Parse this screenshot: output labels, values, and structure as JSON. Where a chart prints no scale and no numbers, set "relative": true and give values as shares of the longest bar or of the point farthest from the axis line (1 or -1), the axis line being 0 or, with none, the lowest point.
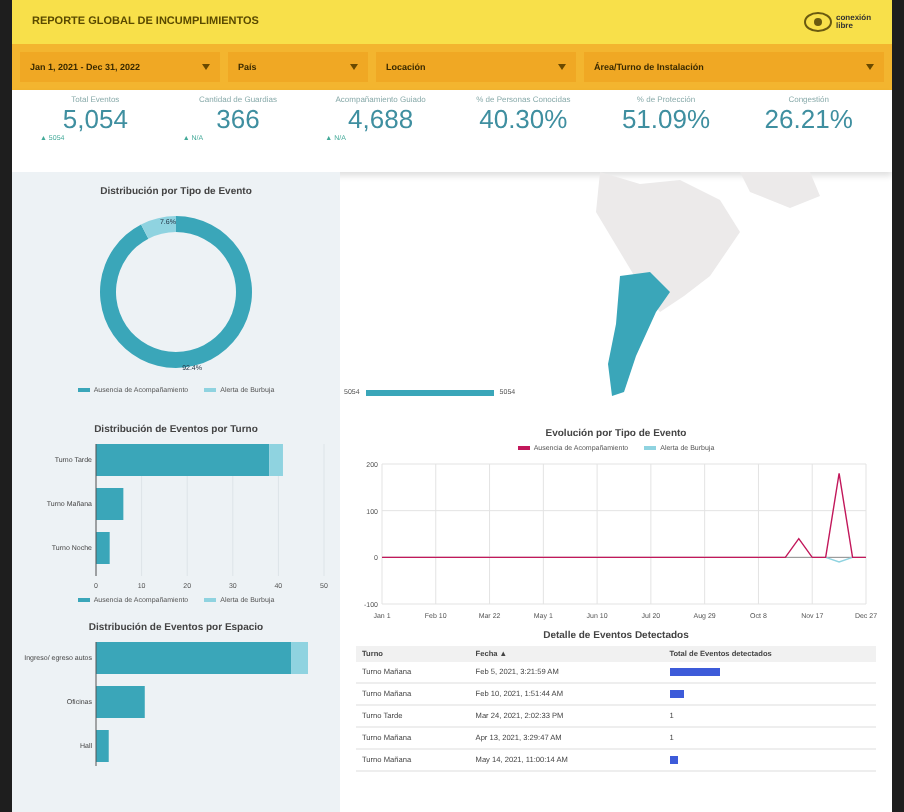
{
  "header": {
    "title": "REPORTE GLOBAL DE INCUMPLIMIENTOS",
    "logo_text": "conexión libre"
  },
  "filters": [
    {
      "label": "Jan 1, 2021 - Dec 31, 2022"
    },
    {
      "label": "País"
    },
    {
      "label": "Locación"
    },
    {
      "label": "Área/Turno de Instalación"
    }
  ],
  "kpis": [
    {
      "label": "Total Eventos",
      "value": "5,054",
      "delta": "▲ 5054"
    },
    {
      "label": "Cantidad de Guardias",
      "value": "366",
      "delta": "▲ N/A"
    },
    {
      "label": "Acompañamiento Guiado",
      "value": "4,688",
      "delta": "▲ N/A"
    },
    {
      "label": "% de Personas Conocidas",
      "value": "40.30%"
    },
    {
      "label": "% de Protección",
      "value": "51.09%"
    },
    {
      "label": "Congestión",
      "value": "26.21%"
    }
  ],
  "donut": {
    "title": "Distribución por Tipo de Evento",
    "chart_data": {
      "type": "donut",
      "categories": [
        "Ausencia de Acompañamiento",
        "Alerta de Burbuja"
      ],
      "values": [
        92.4,
        7.6
      ],
      "colors": [
        "#3aa6b9",
        "#8fd3e0"
      ],
      "value_labels": [
        "92.4%",
        "7.6%"
      ]
    }
  },
  "map": {
    "legend_min": "5054",
    "legend_max": "5054"
  },
  "turno_chart": {
    "title": "Distribución de Eventos por Turno",
    "chart_data": {
      "type": "bar",
      "orientation": "horizontal",
      "stacked": true,
      "categories": [
        "Turno Tarde",
        "Turno Mañana",
        "Turno Noche"
      ],
      "series": [
        {
          "name": "Ausencia de Acompañamiento",
          "color": "#3aa6b9",
          "values": [
            38,
            6,
            3
          ]
        },
        {
          "name": "Alerta de Burbuja",
          "color": "#8fd3e0",
          "values": [
            3,
            0,
            0
          ]
        }
      ],
      "xlim": [
        0,
        50
      ],
      "grid": true,
      "xticks": [
        0,
        10,
        20,
        30,
        40,
        50
      ]
    }
  },
  "espacio_chart": {
    "title": "Distribución de Eventos por Espacio",
    "chart_data": {
      "type": "bar",
      "orientation": "horizontal",
      "stacked": true,
      "relative": true,
      "categories": [
        "Ingreso/ egreso autos",
        "Oficinas",
        "Hall"
      ],
      "series": [
        {
          "color": "#3aa6b9",
          "values": [
            0.92,
            0.23,
            0.06
          ]
        },
        {
          "color": "#8fd3e0",
          "values": [
            0.08,
            0,
            0
          ]
        }
      ]
    }
  },
  "line_chart": {
    "title": "Evolución por Tipo de Evento",
    "chart_data": {
      "type": "line",
      "categories": [
        "Jan 1",
        null,
        null,
        null,
        "Feb 10",
        null,
        null,
        null,
        "Mar 22",
        null,
        null,
        null,
        "May 1",
        null,
        null,
        null,
        "Jun 10",
        null,
        null,
        null,
        "Jul 20",
        null,
        null,
        null,
        "Aug 29",
        null,
        null,
        null,
        "Oct 8",
        null,
        null,
        null,
        "Nov 17",
        null,
        null,
        null,
        "Dec 27"
      ],
      "series": [
        {
          "name": "Ausencia de Acompañamiento",
          "color": "#c2185b",
          "values": [
            0,
            0,
            0,
            0,
            0,
            0,
            0,
            0,
            0,
            0,
            0,
            0,
            0,
            0,
            0,
            0,
            0,
            0,
            0,
            0,
            0,
            0,
            0,
            0,
            0,
            0,
            0,
            0,
            0,
            0,
            0,
            40,
            0,
            0,
            180,
            0,
            0
          ]
        },
        {
          "name": "Alerta de Burbuja",
          "color": "#8fd3e0",
          "values": [
            null,
            null,
            null,
            null,
            null,
            null,
            null,
            null,
            null,
            null,
            null,
            null,
            null,
            null,
            null,
            null,
            null,
            null,
            null,
            null,
            null,
            null,
            null,
            null,
            null,
            null,
            null,
            null,
            null,
            null,
            null,
            null,
            null,
            0,
            -10,
            0,
            null
          ]
        }
      ],
      "ylim": [
        -100,
        200
      ],
      "yticks": [
        -100,
        0,
        100,
        200
      ],
      "grid": true
    }
  },
  "table": {
    "title": "Detalle de Eventos Detectados",
    "columns": [
      "Turno",
      "Fecha ▲",
      "Total de Eventos detectados"
    ],
    "rows": [
      {
        "turno": "Turno Mañana",
        "fecha": "Feb 5, 2021, 3:21:59 AM",
        "kind": "bar",
        "level": 0.25
      },
      {
        "turno": "Turno Mañana",
        "fecha": "Feb 10, 2021, 1:51:44 AM",
        "kind": "bar",
        "level": 0.07
      },
      {
        "turno": "Turno Tarde",
        "fecha": "Mar 24, 2021, 2:02:33 PM",
        "kind": "number",
        "total": "1"
      },
      {
        "turno": "Turno Mañana",
        "fecha": "Apr 13, 2021, 3:29:47 AM",
        "kind": "number",
        "total": "1"
      },
      {
        "turno": "Turno Mañana",
        "fecha": "May 14, 2021, 11:00:14 AM",
        "kind": "bar",
        "level": 0.04
      }
    ]
  }
}
